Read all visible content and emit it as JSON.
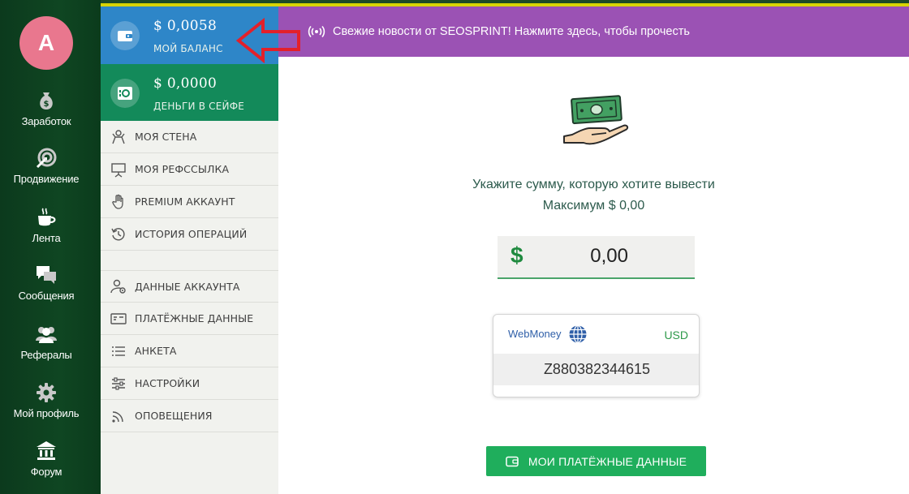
{
  "user": {
    "avatar_letter": "A",
    "avatar_color": "#e9778e"
  },
  "leftnav": {
    "items": [
      {
        "label": "Заработок",
        "icon": "money-bag-icon"
      },
      {
        "label": "Продвижение",
        "icon": "target-icon"
      },
      {
        "label": "Лента",
        "icon": "coffee-cup-icon"
      },
      {
        "label": "Сообщения",
        "icon": "chat-icon"
      },
      {
        "label": "Рефералы",
        "icon": "users-icon"
      },
      {
        "label": "Мой профиль",
        "icon": "gear-icon"
      },
      {
        "label": "Форум",
        "icon": "building-icon"
      }
    ]
  },
  "balances": {
    "main": {
      "amount": "$ 0,0058",
      "caption": "МОЙ БАЛАНС",
      "color": "#2e86c8"
    },
    "safe": {
      "amount": "$ 0,0000",
      "caption": "ДЕНЬГИ В СЕЙФЕ",
      "color": "#138a5a"
    }
  },
  "menu": {
    "group1": [
      {
        "label": "МОЯ СТЕНА",
        "icon": "wall-icon"
      },
      {
        "label": "МОЯ РЕФССЫЛКА",
        "icon": "presentation-icon"
      },
      {
        "label": "PREMIUM АККАУНТ",
        "icon": "hand-icon"
      },
      {
        "label": "ИСТОРИЯ ОПЕРАЦИЙ",
        "icon": "history-icon"
      }
    ],
    "group2": [
      {
        "label": "ДАННЫЕ АККАУНТА",
        "icon": "user-settings-icon"
      },
      {
        "label": "ПЛАТЁЖНЫЕ ДАННЫЕ",
        "icon": "payment-card-icon"
      },
      {
        "label": "АНКЕТА",
        "icon": "list-icon"
      },
      {
        "label": "НАСТРОЙКИ",
        "icon": "sliders-icon"
      },
      {
        "label": "ОПОВЕЩЕНИЯ",
        "icon": "rss-icon"
      }
    ]
  },
  "banner": {
    "text": "Свежие новости от SEOSPRINT! Нажмите здесь, чтобы прочесть",
    "color": "#9b52b4"
  },
  "withdraw": {
    "prompt": "Укажите сумму, которую хотите вывести",
    "max": "Максимум $ 0,00",
    "currency_symbol": "$",
    "amount_value": "0,00"
  },
  "wallet": {
    "provider": "WebMoney",
    "currency": "USD",
    "purse": "Z880382344615"
  },
  "payment_button": {
    "label": "МОИ ПЛАТЁЖНЫЕ ДАННЫЕ",
    "color": "#1fae5c"
  }
}
